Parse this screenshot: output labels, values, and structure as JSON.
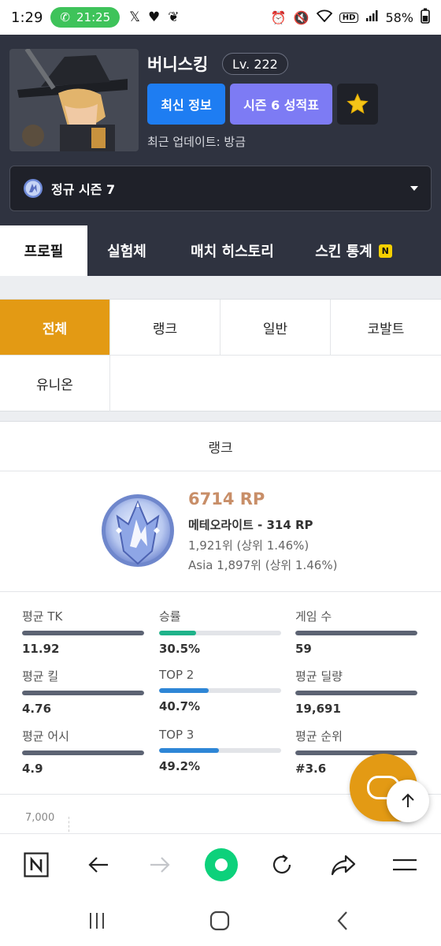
{
  "status_bar": {
    "time": "1:29",
    "call_time": "21:25",
    "battery": "58%"
  },
  "player": {
    "name": "버니스킹",
    "level": "Lv. 222",
    "btn_latest": "최신 정보",
    "btn_season_report": "시즌 6 성적표",
    "updated": "최근 업데이트: 방금"
  },
  "season_select": {
    "selected": "정규 시즌 7"
  },
  "nav_tabs": [
    {
      "label": "프로필",
      "active": true
    },
    {
      "label": "실험체",
      "active": false
    },
    {
      "label": "매치 히스토리",
      "active": false
    },
    {
      "label": "스킨 통계",
      "active": false,
      "badge": "N"
    }
  ],
  "mode_filters": [
    {
      "label": "전체",
      "active": true
    },
    {
      "label": "랭크",
      "active": false
    },
    {
      "label": "일반",
      "active": false
    },
    {
      "label": "코발트",
      "active": false
    },
    {
      "label": "유니온",
      "active": false
    }
  ],
  "rank": {
    "title": "랭크",
    "rp": "6714 RP",
    "tier": "메테오라이트 - 314 RP",
    "rank_global": "1,921위 (상위 1.46%)",
    "rank_region": "Asia 1,897위 (상위 1.46%)",
    "stats": [
      {
        "label": "평균 TK",
        "value": "11.92",
        "fill": 1.0,
        "color": "#5c6373"
      },
      {
        "label": "승률",
        "value": "30.5%",
        "fill": 0.305,
        "color": "#1fb38a"
      },
      {
        "label": "게임 수",
        "value": "59",
        "fill": 1.0,
        "color": "#5c6373"
      },
      {
        "label": "평균 킬",
        "value": "4.76",
        "fill": 1.0,
        "color": "#5c6373"
      },
      {
        "label": "TOP 2",
        "value": "40.7%",
        "fill": 0.407,
        "color": "#2e86d6"
      },
      {
        "label": "평균 딜량",
        "value": "19,691",
        "fill": 1.0,
        "color": "#5c6373"
      },
      {
        "label": "평균 어시",
        "value": "4.9",
        "fill": 1.0,
        "color": "#5c6373"
      },
      {
        "label": "TOP 3",
        "value": "49.2%",
        "fill": 0.492,
        "color": "#2e86d6"
      },
      {
        "label": "평균 순위",
        "value": "#3.6",
        "fill": 1.0,
        "color": "#5c6373"
      }
    ],
    "chart_tick_top": "7,000"
  },
  "colors": {
    "accent_orange": "#e39a14",
    "blue_button": "#1e7df2",
    "purple_button": "#7d7bf4",
    "header_bg": "#2f3340"
  }
}
